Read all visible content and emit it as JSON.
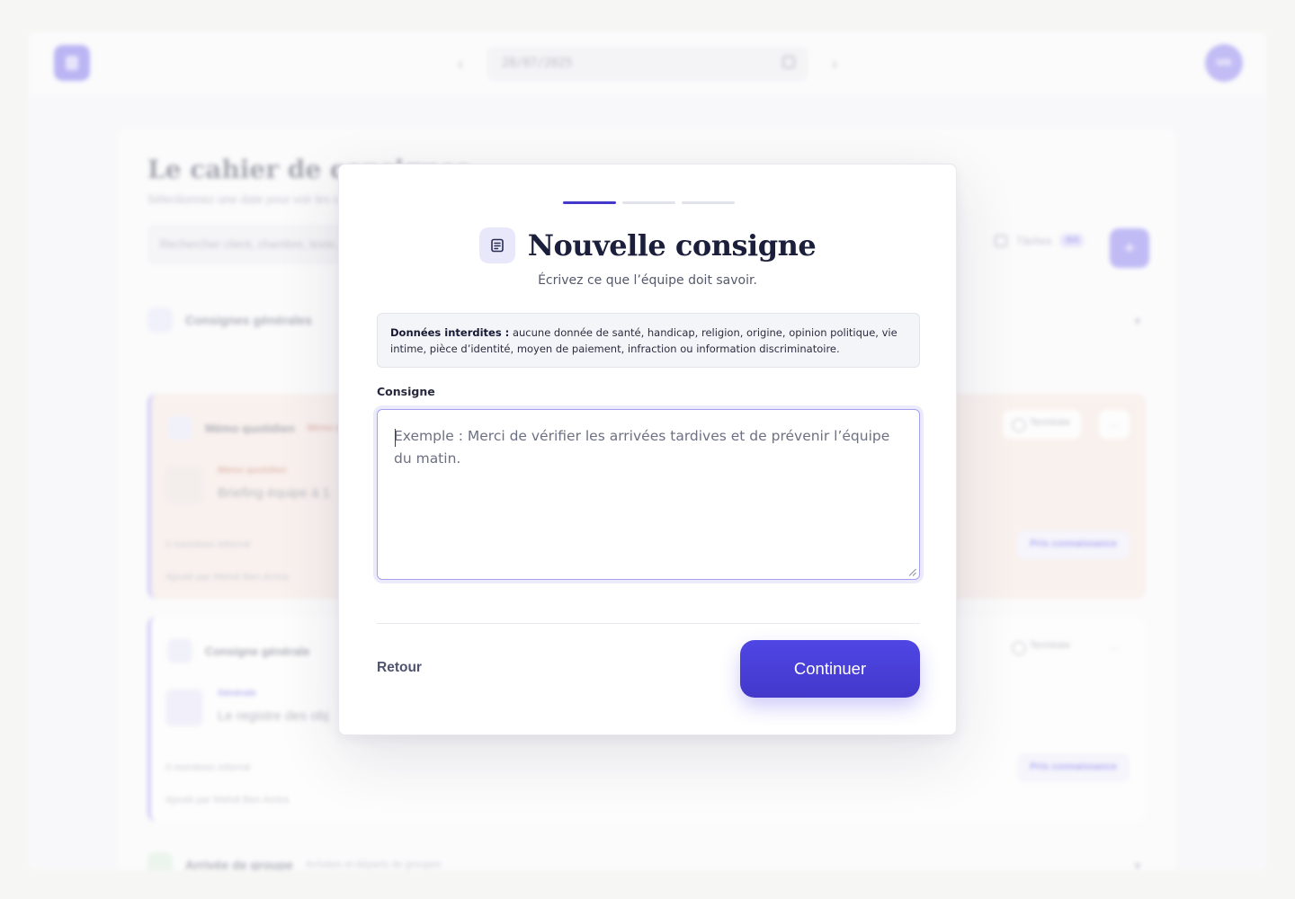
{
  "background": {
    "date_value": "28/07/2025",
    "avatar_initials": "MB",
    "page_title": "Le cahier de consignes",
    "page_subtitle": "Sélectionnez une date pour voir les consignes",
    "search_placeholder": "Rechercher client, chambre, texte...",
    "filter_label": "Tâches",
    "filter_count": "0/4",
    "add_label": "+",
    "section_general": "Consignes générales",
    "section_arrivals": "Arrivée de groupe",
    "section_arrivals_subtitle": "Arrivées et départs de groupes",
    "cards": [
      {
        "title": "Mémo quotidien",
        "tag": "Mémo quotidien",
        "text": "Briefing équipe à 1",
        "meta_views": "0 membres informé",
        "meta_author": "Ajouté par Mehdi Ben Amira",
        "done_label": "Terminée",
        "ack_label": "Pris connaissance"
      },
      {
        "title": "Consigne générale",
        "tag": "Générale",
        "text": "Le registre des obj",
        "meta_views": "0 membres informé",
        "meta_author": "Ajouté par Mehdi Ben Amira",
        "done_label": "Terminée",
        "ack_label": "Pris connaissance"
      }
    ],
    "colors": {
      "accent": "#4f46e5",
      "accent_dark": "#4338ca"
    }
  },
  "modal": {
    "steps": [
      {
        "label": "step-1",
        "active": true
      },
      {
        "label": "step-2",
        "active": false
      },
      {
        "label": "step-3",
        "active": false
      }
    ],
    "icon": "document-icon",
    "title": "Nouvelle consigne",
    "subtitle": "Écrivez ce que l’équipe doit savoir.",
    "warning_strong": "Données interdites :",
    "warning_text": " aucune donnée de santé, handicap, religion, origine, opinion politique, vie intime, pièce d’identité, moyen de paiement, infraction ou information discriminatoire.",
    "field_label": "Consigne",
    "textarea_value": "",
    "textarea_placeholder": "Exemple : Merci de vérifier les arrivées tardives et de prévenir l’équipe du matin.",
    "back_label": "Retour",
    "continue_label": "Continuer"
  }
}
